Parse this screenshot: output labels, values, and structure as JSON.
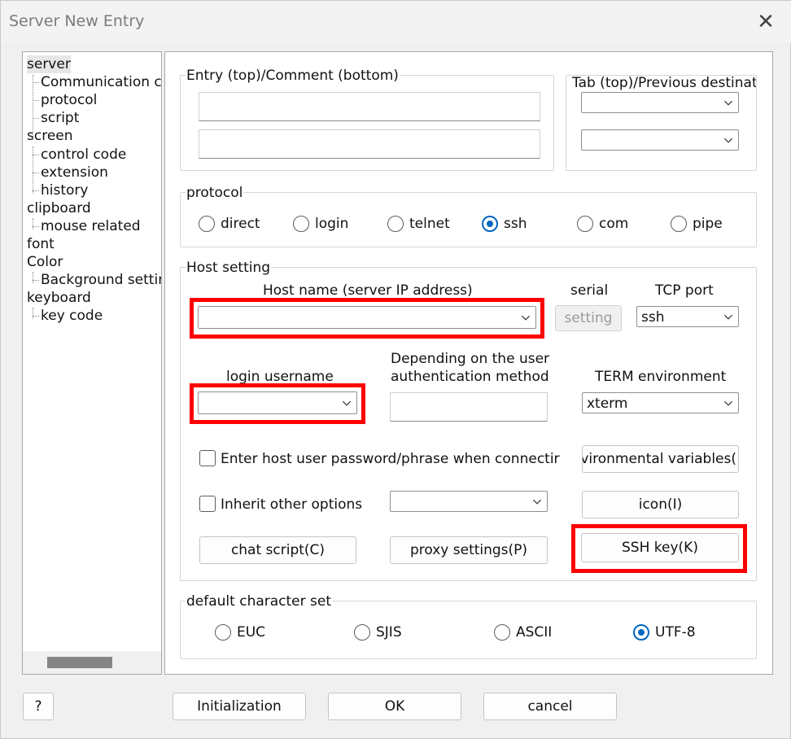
{
  "window": {
    "title": "Server New Entry"
  },
  "tree": {
    "items": [
      {
        "label": "server",
        "level": 0,
        "selected": true
      },
      {
        "label": "Communication co",
        "level": 1
      },
      {
        "label": "protocol",
        "level": 1
      },
      {
        "label": "script",
        "level": 1
      },
      {
        "label": "screen",
        "level": 0
      },
      {
        "label": "control code",
        "level": 1
      },
      {
        "label": "extension",
        "level": 1
      },
      {
        "label": "history",
        "level": 1
      },
      {
        "label": "clipboard",
        "level": 0
      },
      {
        "label": "mouse related",
        "level": 1
      },
      {
        "label": "font",
        "level": 0
      },
      {
        "label": "Color",
        "level": 0
      },
      {
        "label": "Background settir",
        "level": 1
      },
      {
        "label": "keyboard",
        "level": 0
      },
      {
        "label": "key code",
        "level": 1
      }
    ]
  },
  "entry": {
    "legend": "Entry (top)/Comment (bottom)",
    "entry_value": "",
    "comment_value": ""
  },
  "tab": {
    "legend": "Tab (top)/Previous destinatio",
    "tab_value": "",
    "previous_value": ""
  },
  "protocol": {
    "legend": "protocol",
    "options": [
      "direct",
      "login",
      "telnet",
      "ssh",
      "com",
      "pipe"
    ],
    "selected": "ssh"
  },
  "host": {
    "legend": "Host setting",
    "hostname_label": "Host name (server IP address)",
    "hostname_value": "",
    "serial_label": "serial",
    "setting_button": "setting",
    "tcp_label": "TCP port",
    "tcp_value": "ssh",
    "login_label": "login username",
    "login_value": "",
    "auth_label_1": "Depending on the user",
    "auth_label_2": "authentication method",
    "auth_value": "",
    "term_label": "TERM environment",
    "term_value": "xterm",
    "password_check_label": "Enter host user password/phrase when connectir",
    "env_button": "nvironmental variables(",
    "inherit_check_label": "Inherit other options",
    "inherit_value": "",
    "icon_button": "icon(I)",
    "chat_button": "chat script(C)",
    "proxy_button": "proxy settings(P)",
    "ssh_key_button": "SSH key(K)"
  },
  "charset": {
    "legend": "default character set",
    "options": [
      "EUC",
      "SJIS",
      "ASCII",
      "UTF-8"
    ],
    "selected": "UTF-8"
  },
  "footer": {
    "help_button": "?",
    "init_button": "Initialization",
    "ok_button": "OK",
    "cancel_button": "cancel"
  },
  "colors": {
    "highlight": "#ff0000",
    "accent": "#0067c0"
  }
}
